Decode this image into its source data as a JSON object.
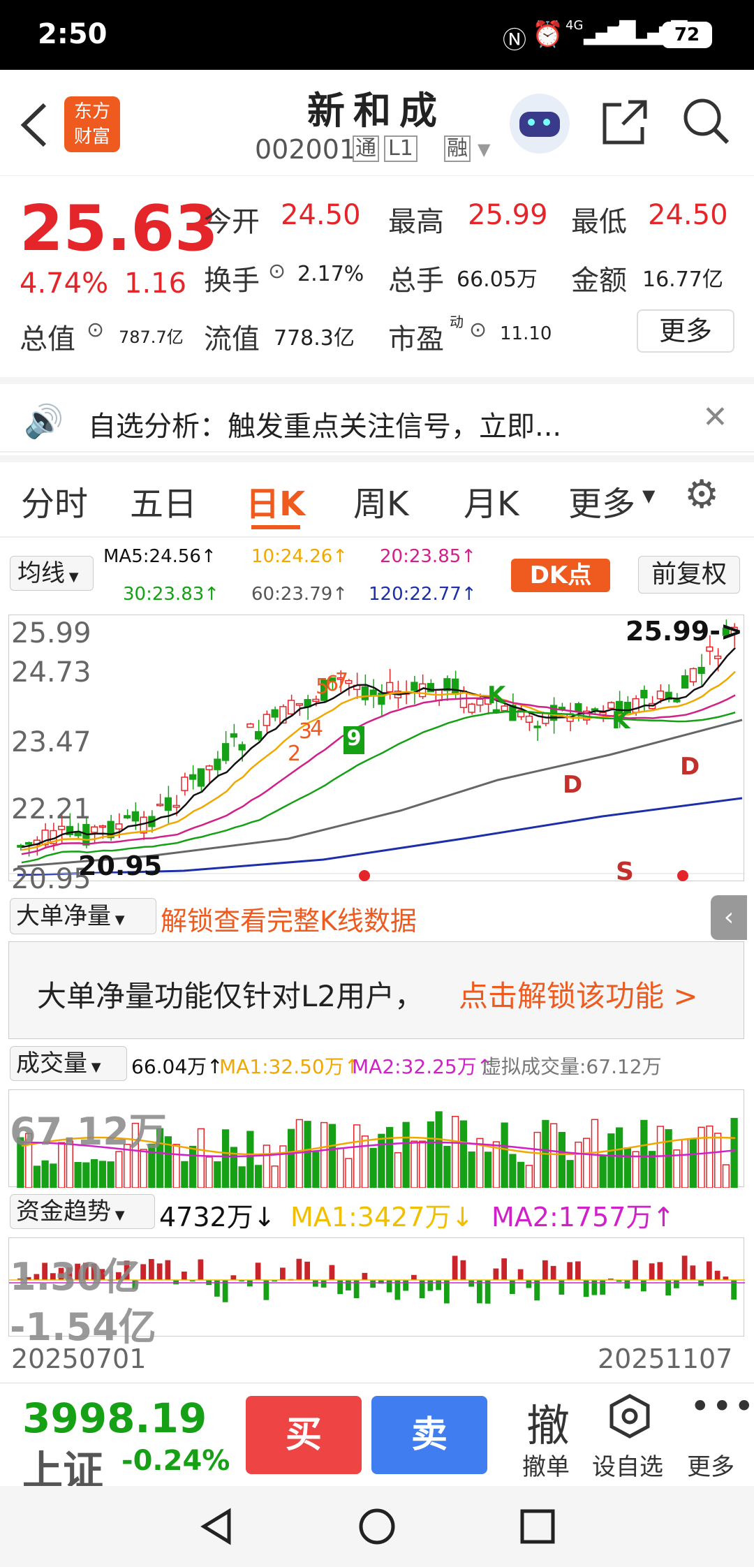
{
  "status": {
    "time": "2:50",
    "battery": "72",
    "net1": "4G",
    "net2": "4G"
  },
  "header": {
    "title": "新和成",
    "code": "002001",
    "tag_tong": "通",
    "tag_level": "L1",
    "tag_rong": "融",
    "logo_top": "东方",
    "logo_bottom": "财富"
  },
  "quote": {
    "price": "25.63",
    "pct": "4.74%",
    "chg": "1.16",
    "open_label": "今开",
    "open": "24.50",
    "high_label": "最高",
    "high": "25.99",
    "low_label": "最低",
    "low": "24.50",
    "turnover_label": "换手",
    "turnover": "2.17%",
    "vol_label": "总手",
    "vol": "66.05万",
    "amount_label": "金额",
    "amount": "16.77亿",
    "mcap_label": "总值",
    "mcap": "787.7亿",
    "float_label": "流值",
    "float": "778.3亿",
    "pe_label": "市盈",
    "pe_sup": "动",
    "pe": "11.10",
    "more": "更多"
  },
  "notice": {
    "text": "自选分析：触发重点关注信号，立即..."
  },
  "tabs": [
    "分时",
    "五日",
    "日K",
    "周K",
    "月K",
    "更多"
  ],
  "active_tab": "日K",
  "ma_bar": {
    "select": "均线",
    "ma5": "MA5:24.56↑",
    "ma10": "10:24.26↑",
    "ma20": "20:23.85↑",
    "ma30": "30:23.83↑",
    "ma60": "60:23.79↑",
    "ma120": "120:22.77↑",
    "dk": "DK点",
    "fq": "前复权"
  },
  "kchart": {
    "y_labels": [
      "25.99",
      "24.73",
      "23.47",
      "22.21",
      "20.95"
    ],
    "high_marker": "25.99->",
    "low_marker": "20.95",
    "signals": [
      "K",
      "K",
      "D",
      "D",
      "S",
      "9"
    ],
    "nums": [
      "2",
      "3",
      "4",
      "5",
      "6",
      "7"
    ],
    "colors": {
      "up": "#e4262b",
      "down": "#16a016",
      "ma5": "#111111",
      "ma10": "#f0a800",
      "ma20": "#d0208a",
      "ma30": "#16a016",
      "ma60": "#666666",
      "ma120": "#1c2fa8"
    }
  },
  "bigorder": {
    "select": "大单净量",
    "unlock": "解锁查看完整K线数据",
    "msg_black": "大单净量功能仅针对L2用户，",
    "msg_orange": "点击解锁该功能 >"
  },
  "volume": {
    "select": "成交量",
    "v": "66.04万↑",
    "ma1": "MA1:32.50万↑",
    "ma2": "MA2:32.25万↑",
    "virtual": "虚拟成交量:67.12万",
    "label": "67.12万"
  },
  "fund": {
    "select": "资金趋势",
    "v": "4732万↓",
    "ma1": "MA1:3427万↓",
    "ma2": "MA2:1757万↑",
    "top": "1.30亿",
    "bottom": "-1.54亿"
  },
  "dates": {
    "start": "20250701",
    "end": "20251107"
  },
  "bottom": {
    "index_val": "3998.19",
    "index_name": "上证",
    "index_pct": "-0.24%",
    "buy": "买",
    "sell": "卖",
    "cancel_icon": "撤",
    "cancel": "撤单",
    "fav": "设自选",
    "more": "更多"
  }
}
